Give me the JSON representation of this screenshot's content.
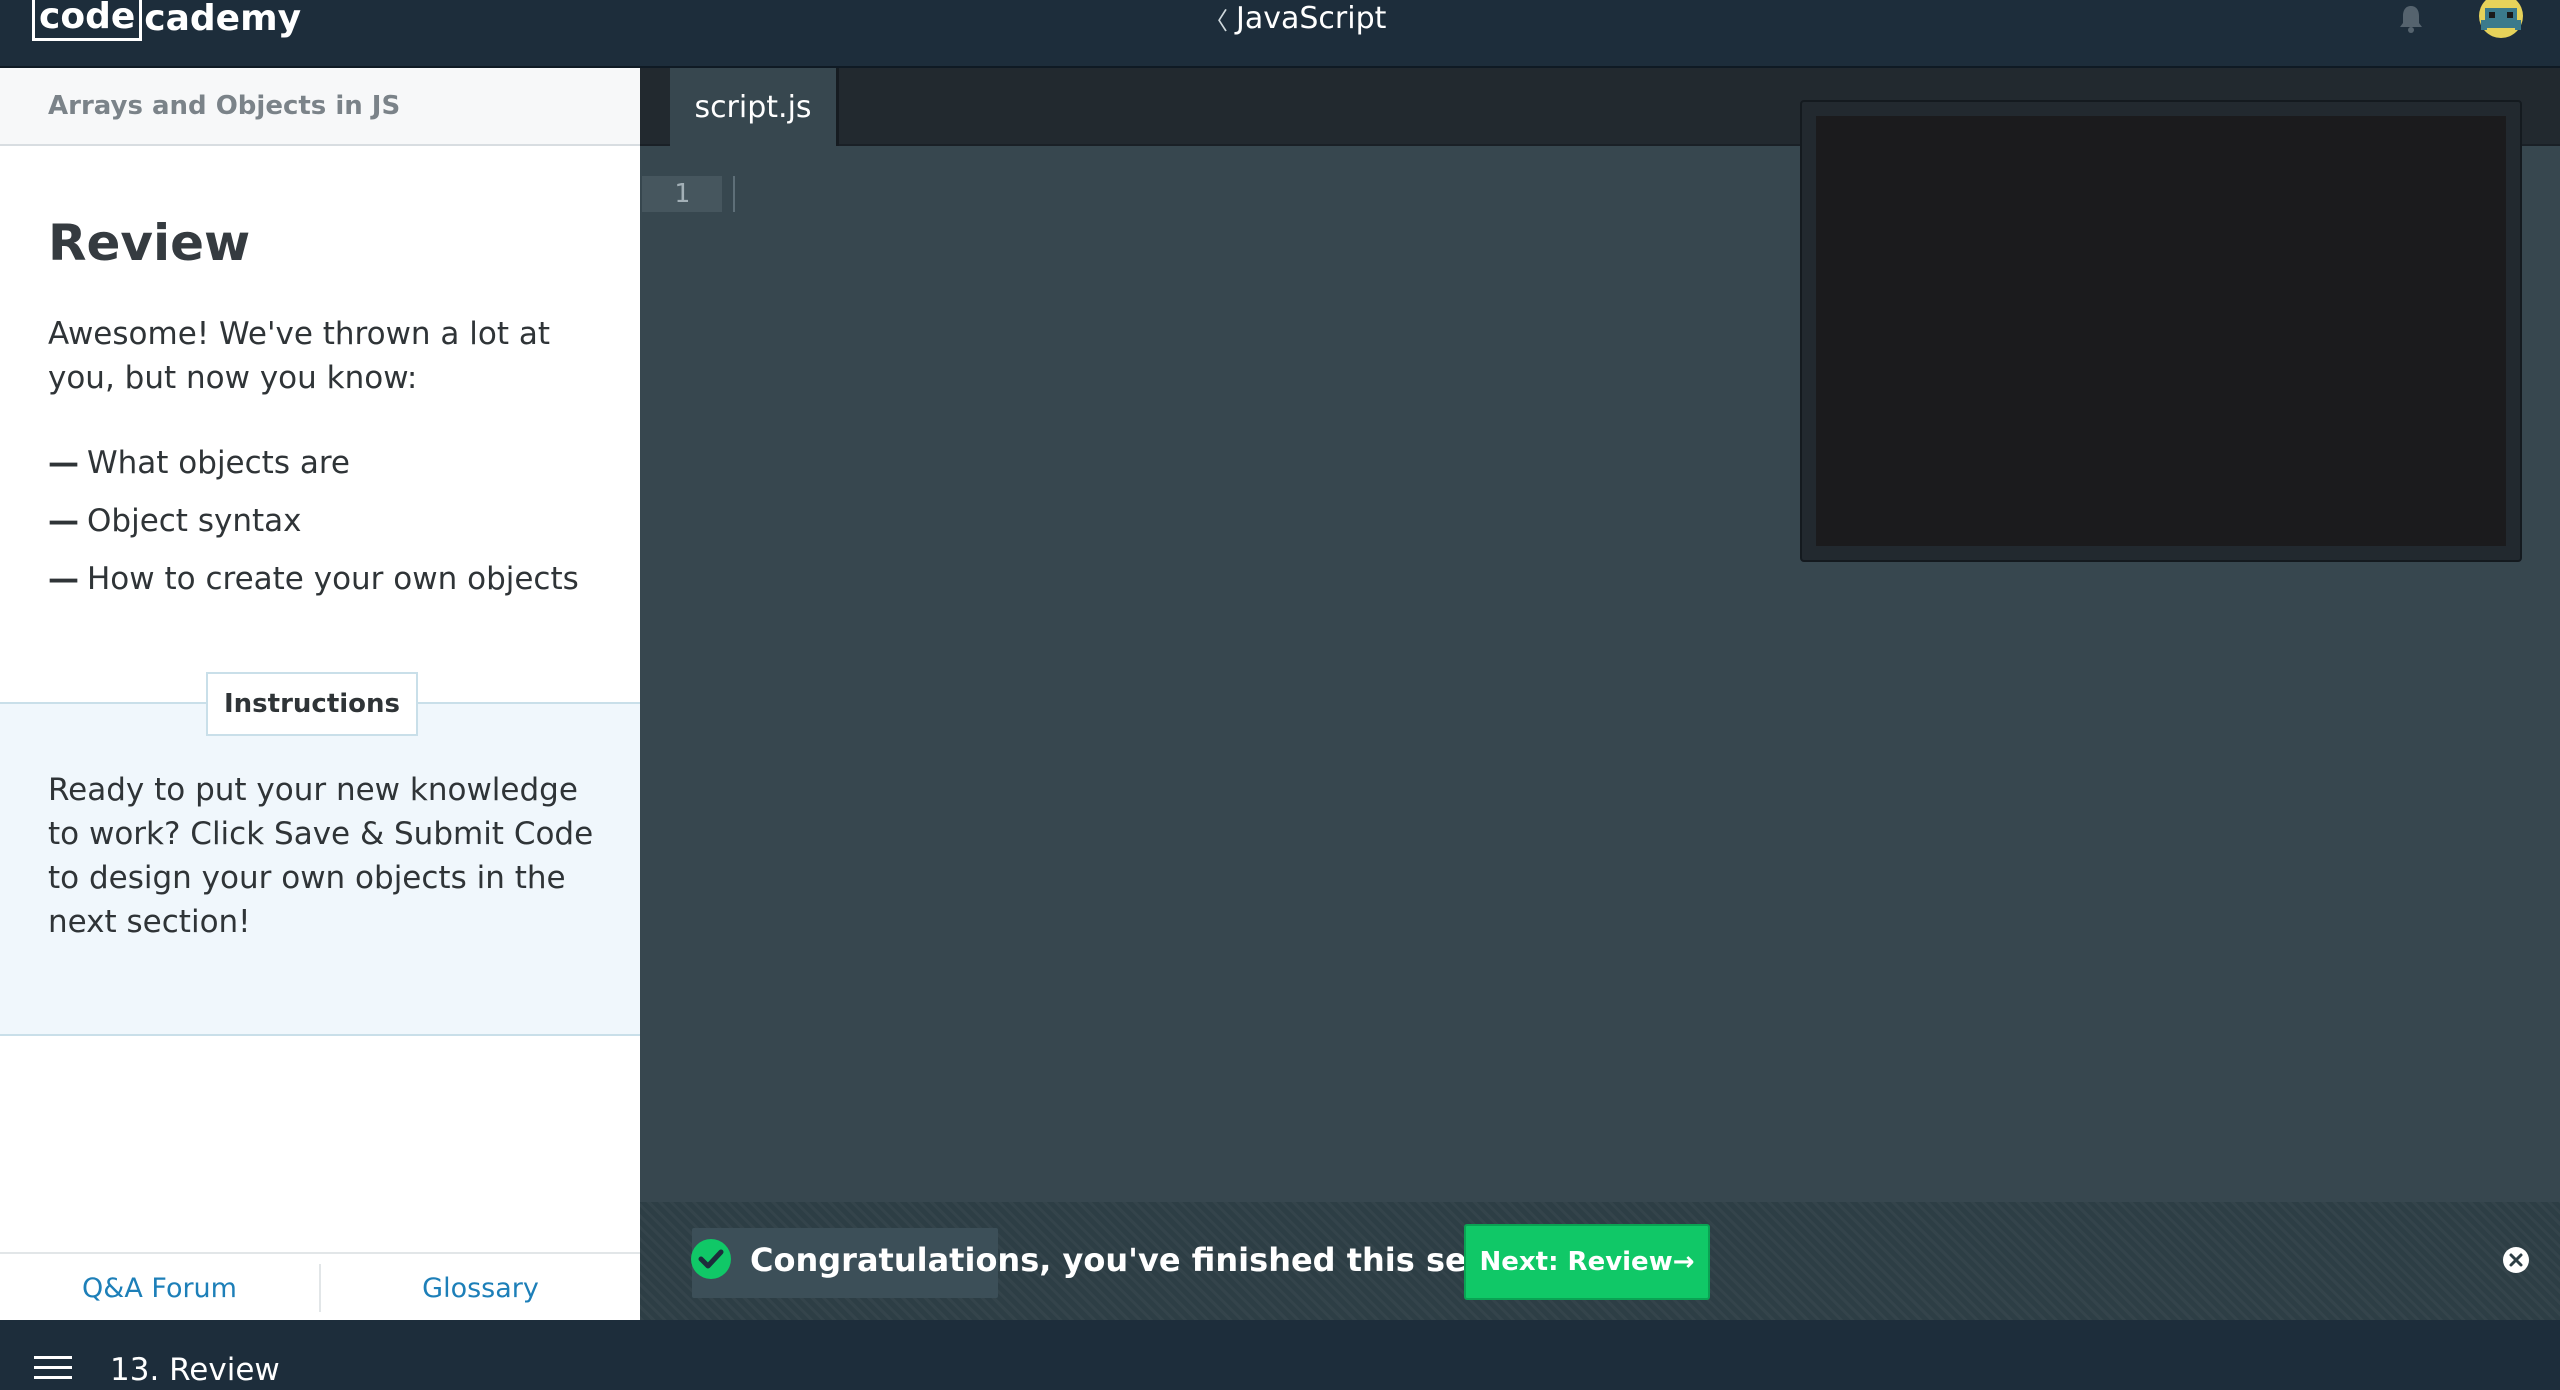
{
  "topbar": {
    "logo_code": "code",
    "logo_cademy": "cademy",
    "course_chevron": "〈",
    "course_name": "JavaScript",
    "icons": [
      "bell-icon",
      "avatar-icon"
    ]
  },
  "lesson": {
    "header": "Arrays and Objects in JS",
    "title": "Review",
    "intro": "Awesome! We've thrown a lot at you, but now you know:",
    "list_dash": "—",
    "list": [
      "What objects are",
      "Object syntax",
      "How to create your own objects"
    ]
  },
  "instructions": {
    "tab_label": "Instructions",
    "text": "Ready to put your new knowledge to work? Click Save & Submit Code to design your own objects in the next section!"
  },
  "footer": {
    "qa_forum": "Q&A Forum",
    "glossary": "Glossary"
  },
  "editor": {
    "file_tab": "script.js",
    "line_number": "1"
  },
  "congrats": {
    "message": "Congratulations, you've finished this section!",
    "next_button": "Next: Review→",
    "icons": [
      "check-circle-icon",
      "close-icon"
    ]
  },
  "bottombar": {
    "exercise": "13. Review",
    "icons": [
      "menu-icon"
    ]
  },
  "colors": {
    "navy": "#1d2d3b",
    "editor_bg": "#37474f",
    "accent_green": "#10c867",
    "link_blue": "#1d7fb8"
  }
}
